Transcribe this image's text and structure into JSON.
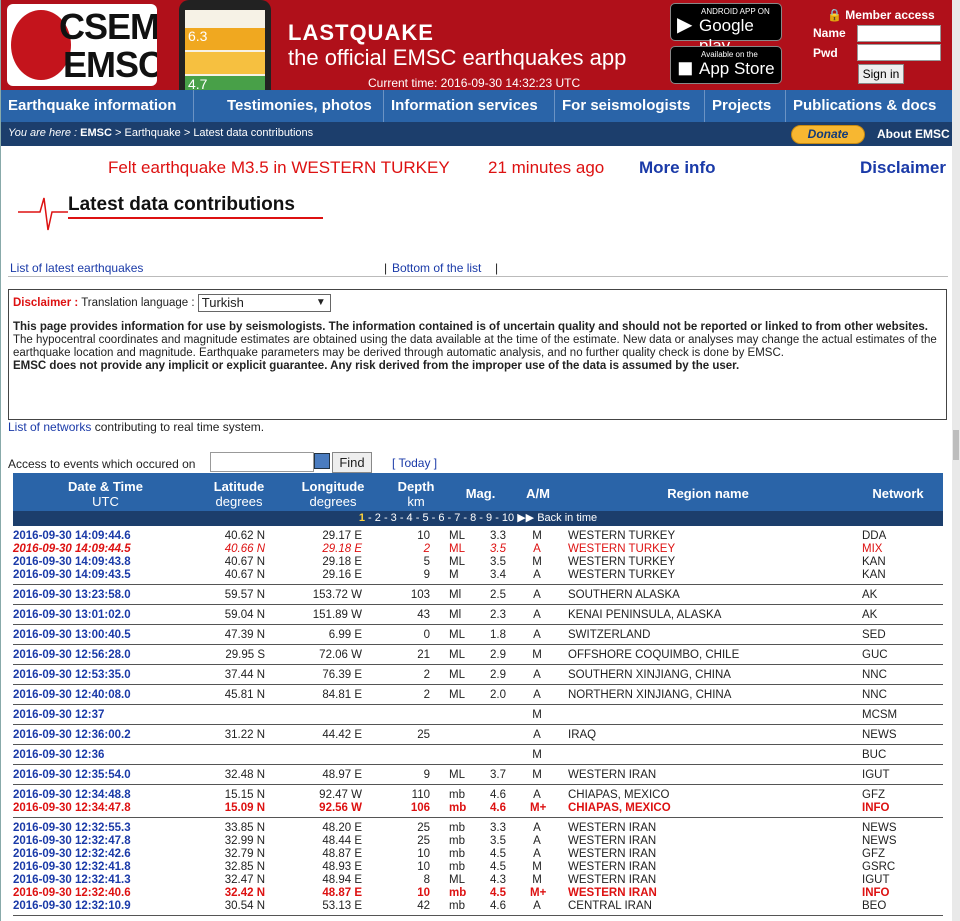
{
  "header": {
    "logo_line1": "CSEM",
    "logo_line2": "EMSC",
    "app_title": "LASTQUAKE",
    "app_subtitle": "the official EMSC earthquakes app",
    "current_time": "Current time: 2016-09-30 14:32:23 UTC",
    "google_play_small": "ANDROID APP ON",
    "google_play_big": "Google play",
    "app_store_small": "Available on the",
    "app_store_big": "App Store",
    "member_access": "Member access",
    "name_label": "Name",
    "pwd_label": "Pwd",
    "sign_in": "Sign in",
    "phone_mag1": "6.3",
    "phone_mag2": "4.7"
  },
  "nav": {
    "items": [
      "Earthquake information",
      "Testimonies, photos",
      "Information services",
      "For seismologists",
      "Projects",
      "Publications & docs"
    ]
  },
  "breadcrumb": {
    "prefix": "You are here :",
    "emsc": "EMSC",
    "sep1": " > ",
    "earthquake": "Earthquake",
    "sep2": " > ",
    "current": "Latest data contributions",
    "donate": "Donate",
    "about": "About EMSC"
  },
  "felt": {
    "text": "Felt earthquake M3.5 in WESTERN TURKEY",
    "ago": "21 minutes ago",
    "more_info": "More info",
    "disclaimer": "Disclaimer"
  },
  "section": {
    "title": "Latest data contributions",
    "list_link": "List of latest earthquakes",
    "sep": "|",
    "bottom_link": "Bottom of the list",
    "sep_end": "|"
  },
  "disclaimer": {
    "label": "Disclaimer :",
    "translation_label": "Translation language :",
    "language": "Turkish",
    "p1": "This page provides information for use by seismologists. The information contained is of uncertain quality and should not be reported or linked to from other websites.",
    "p2": "The hypocentral coordinates and magnitude estimates are obtained using the data available at the time of the estimate. New data or analyses may change the actual estimates of the earthquake location and magnitude. Earthquake parameters may be derived through automatic analysis, and no further quality check is done by EMSC.",
    "p3": "EMSC does not provide any implicit or explicit guarantee. Any risk derived from the improper use of the data is assumed by the user."
  },
  "networks": {
    "link": "List of networks",
    "text": "contributing to real time system."
  },
  "access": {
    "label": "Access to events which occured on",
    "find": "Find",
    "today": "[ Today ]"
  },
  "table": {
    "headers": {
      "datetime": "Date & Time",
      "datetime_sub": "UTC",
      "lat": "Latitude",
      "lat_sub": "degrees",
      "lon": "Longitude",
      "lon_sub": "degrees",
      "depth": "Depth",
      "depth_sub": "km",
      "mag": "Mag.",
      "am": "A/M",
      "region": "Region name",
      "network": "Network"
    },
    "pager": {
      "current": "1",
      "rest": " - 2 - 3 - 4 - 5 - 6 - 7 - 8 - 9 - 10",
      "back": "Back in time"
    },
    "groups": [
      {
        "rows": [
          {
            "dt": "2016-09-30  14:09:44.6",
            "lat": "40.62 N",
            "lon": "29.17 E",
            "dep": "10",
            "mt": "ML",
            "mag": "3.3",
            "am": "M",
            "reg": "WESTERN TURKEY",
            "net": "DDA",
            "style": ""
          },
          {
            "dt": "2016-09-30  14:09:44.5",
            "lat": "40.66 N",
            "lon": "29.18 E",
            "dep": "2",
            "mt": "ML",
            "mag": "3.5",
            "am": "A",
            "reg": "WESTERN TURKEY",
            "net": "MIX",
            "style": "red auto"
          },
          {
            "dt": "2016-09-30  14:09:43.8",
            "lat": "40.67 N",
            "lon": "29.18 E",
            "dep": "5",
            "mt": "ML",
            "mag": "3.5",
            "am": "M",
            "reg": "WESTERN TURKEY",
            "net": "KAN",
            "style": ""
          },
          {
            "dt": "2016-09-30  14:09:43.5",
            "lat": "40.67 N",
            "lon": "29.16 E",
            "dep": "9",
            "mt": "M",
            "mag": "3.4",
            "am": "A",
            "reg": "WESTERN TURKEY",
            "net": "KAN",
            "style": ""
          }
        ]
      },
      {
        "rows": [
          {
            "dt": "2016-09-30  13:23:58.0",
            "lat": "59.57 N",
            "lon": "153.72 W",
            "dep": "103",
            "mt": "Ml",
            "mag": "2.5",
            "am": "A",
            "reg": "SOUTHERN ALASKA",
            "net": "AK",
            "style": ""
          }
        ]
      },
      {
        "rows": [
          {
            "dt": "2016-09-30  13:01:02.0",
            "lat": "59.04 N",
            "lon": "151.89 W",
            "dep": "43",
            "mt": "Ml",
            "mag": "2.3",
            "am": "A",
            "reg": "KENAI PENINSULA, ALASKA",
            "net": "AK",
            "style": ""
          }
        ]
      },
      {
        "rows": [
          {
            "dt": "2016-09-30  13:00:40.5",
            "lat": "47.39 N",
            "lon": "6.99 E",
            "dep": "0",
            "mt": "ML",
            "mag": "1.8",
            "am": "A",
            "reg": "SWITZERLAND",
            "net": "SED",
            "style": ""
          }
        ]
      },
      {
        "rows": [
          {
            "dt": "2016-09-30  12:56:28.0",
            "lat": "29.95 S",
            "lon": "72.06 W",
            "dep": "21",
            "mt": "ML",
            "mag": "2.9",
            "am": "M",
            "reg": "OFFSHORE COQUIMBO, CHILE",
            "net": "GUC",
            "style": ""
          }
        ]
      },
      {
        "rows": [
          {
            "dt": "2016-09-30  12:53:35.0",
            "lat": "37.44 N",
            "lon": "76.39 E",
            "dep": "2",
            "mt": "ML",
            "mag": "2.9",
            "am": "A",
            "reg": "SOUTHERN XINJIANG, CHINA",
            "net": "NNC",
            "style": ""
          }
        ]
      },
      {
        "rows": [
          {
            "dt": "2016-09-30  12:40:08.0",
            "lat": "45.81 N",
            "lon": "84.81 E",
            "dep": "2",
            "mt": "ML",
            "mag": "2.0",
            "am": "A",
            "reg": "NORTHERN XINJIANG, CHINA",
            "net": "NNC",
            "style": ""
          }
        ]
      },
      {
        "rows": [
          {
            "dt": "2016-09-30  12:37",
            "lat": "",
            "lon": "",
            "dep": "",
            "mt": "",
            "mag": "",
            "am": "M",
            "reg": "",
            "net": "MCSM",
            "style": ""
          }
        ]
      },
      {
        "rows": [
          {
            "dt": "2016-09-30  12:36:00.2",
            "lat": "31.22 N",
            "lon": "44.42 E",
            "dep": "25",
            "mt": "",
            "mag": "",
            "am": "A",
            "reg": "IRAQ",
            "net": "NEWS",
            "style": ""
          }
        ]
      },
      {
        "rows": [
          {
            "dt": "2016-09-30  12:36",
            "lat": "",
            "lon": "",
            "dep": "",
            "mt": "",
            "mag": "",
            "am": "M",
            "reg": "",
            "net": "BUC",
            "style": ""
          }
        ]
      },
      {
        "rows": [
          {
            "dt": "2016-09-30  12:35:54.0",
            "lat": "32.48 N",
            "lon": "48.97 E",
            "dep": "9",
            "mt": "ML",
            "mag": "3.7",
            "am": "M",
            "reg": "WESTERN IRAN",
            "net": "IGUT",
            "style": ""
          }
        ]
      },
      {
        "rows": [
          {
            "dt": "2016-09-30  12:34:48.8",
            "lat": "15.15 N",
            "lon": "92.47 W",
            "dep": "110",
            "mt": "mb",
            "mag": "4.6",
            "am": "A",
            "reg": "CHIAPAS, MEXICO",
            "net": "GFZ",
            "style": ""
          },
          {
            "dt": "2016-09-30  12:34:47.8",
            "lat": "15.09 N",
            "lon": "92.56 W",
            "dep": "106",
            "mt": "mb",
            "mag": "4.6",
            "am": "M+",
            "reg": "CHIAPAS, MEXICO",
            "net": "INFO",
            "style": "redb"
          }
        ]
      },
      {
        "rows": [
          {
            "dt": "2016-09-30  12:32:55.3",
            "lat": "33.85 N",
            "lon": "48.20 E",
            "dep": "25",
            "mt": "mb",
            "mag": "3.3",
            "am": "A",
            "reg": "WESTERN IRAN",
            "net": "NEWS",
            "style": ""
          },
          {
            "dt": "2016-09-30  12:32:47.8",
            "lat": "32.99 N",
            "lon": "48.44 E",
            "dep": "25",
            "mt": "mb",
            "mag": "3.5",
            "am": "A",
            "reg": "WESTERN IRAN",
            "net": "NEWS",
            "style": ""
          },
          {
            "dt": "2016-09-30  12:32:42.6",
            "lat": "32.79 N",
            "lon": "48.87 E",
            "dep": "10",
            "mt": "mb",
            "mag": "4.5",
            "am": "A",
            "reg": "WESTERN IRAN",
            "net": "GFZ",
            "style": ""
          },
          {
            "dt": "2016-09-30  12:32:41.8",
            "lat": "32.85 N",
            "lon": "48.93 E",
            "dep": "10",
            "mt": "mb",
            "mag": "4.5",
            "am": "M",
            "reg": "WESTERN IRAN",
            "net": "GSRC",
            "style": ""
          },
          {
            "dt": "2016-09-30  12:32:41.3",
            "lat": "32.47 N",
            "lon": "48.94 E",
            "dep": "8",
            "mt": "ML",
            "mag": "4.3",
            "am": "M",
            "reg": "WESTERN IRAN",
            "net": "IGUT",
            "style": ""
          },
          {
            "dt": "2016-09-30  12:32:40.6",
            "lat": "32.42 N",
            "lon": "48.87 E",
            "dep": "10",
            "mt": "mb",
            "mag": "4.5",
            "am": "M+",
            "reg": "WESTERN IRAN",
            "net": "INFO",
            "style": "redb"
          },
          {
            "dt": "2016-09-30  12:32:10.9",
            "lat": "30.54 N",
            "lon": "53.13 E",
            "dep": "42",
            "mt": "mb",
            "mag": "4.6",
            "am": "A",
            "reg": "CENTRAL IRAN",
            "net": "BEO",
            "style": ""
          }
        ]
      }
    ]
  }
}
